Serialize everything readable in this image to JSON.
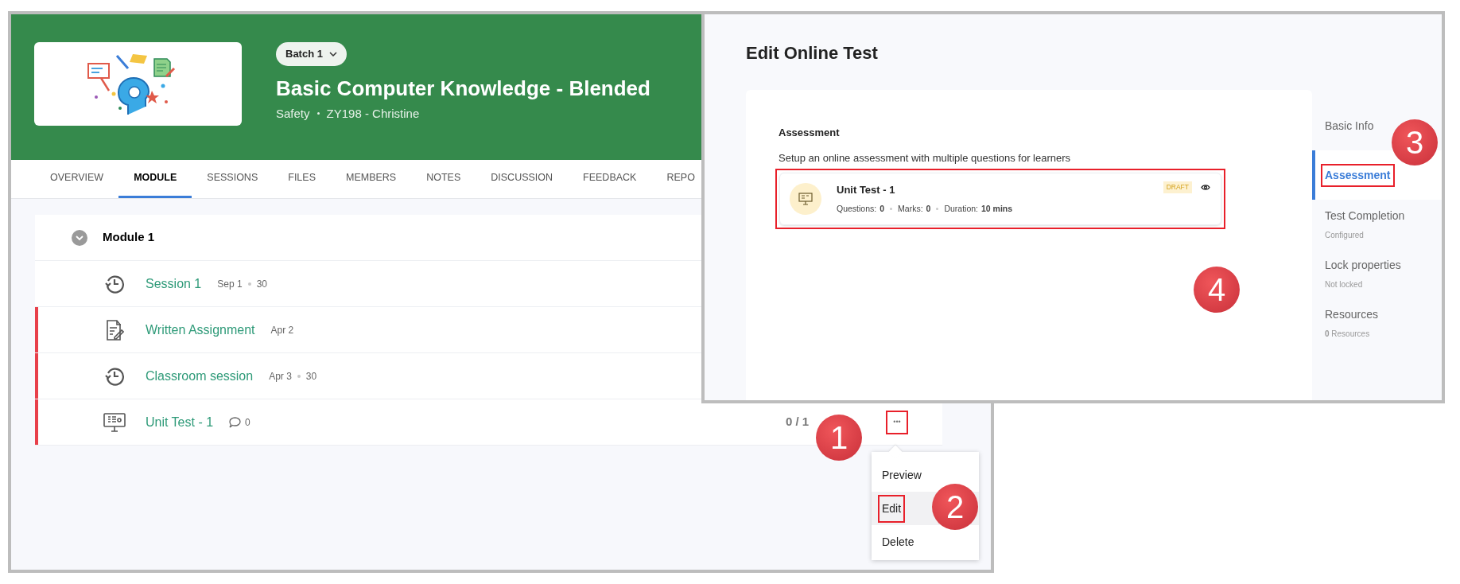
{
  "course_window": {
    "banner": {
      "batch": "Batch 1",
      "title": "Basic Computer Knowledge - Blended",
      "subtitle": [
        "Safety",
        "ZY198 - Christine"
      ]
    },
    "tabs": [
      {
        "label": "OVERVIEW",
        "selected": false
      },
      {
        "label": "MODULE",
        "selected": true
      },
      {
        "label": "SESSIONS",
        "selected": false
      },
      {
        "label": "FILES",
        "selected": false
      },
      {
        "label": "MEMBERS",
        "selected": false
      },
      {
        "label": "NOTES",
        "selected": false
      },
      {
        "label": "DISCUSSION",
        "selected": false
      },
      {
        "label": "FEEDBACK",
        "selected": false
      },
      {
        "label": "REPO",
        "selected": false
      }
    ],
    "module": {
      "title": "Module 1",
      "expanded": true
    },
    "items": [
      {
        "kind": "session",
        "title": "Session 1",
        "meta": [
          "Sep 1",
          "30"
        ],
        "flagged": false
      },
      {
        "kind": "assignment",
        "title": "Written Assignment",
        "meta": [
          "Apr 2"
        ],
        "flagged": true
      },
      {
        "kind": "session",
        "title": "Classroom session",
        "meta": [
          "Apr 3",
          "30"
        ],
        "flagged": true
      },
      {
        "kind": "test",
        "title": "Unit Test - 1",
        "comments": "0",
        "progress": "0 / 1",
        "more": "•••",
        "more_annotated": true,
        "flagged": true
      }
    ],
    "menu": [
      {
        "label": "Preview",
        "hovered": false,
        "annotated": false
      },
      {
        "label": "Edit",
        "hovered": true,
        "annotated": true
      },
      {
        "label": "Delete",
        "hovered": false,
        "annotated": false
      }
    ]
  },
  "edit_window": {
    "title": "Edit Online Test",
    "section_title": "Assessment",
    "description": "Setup an online assessment with multiple questions for learners",
    "test_card": {
      "title": "Unit Test - 1",
      "status": "DRAFT",
      "annotated": true,
      "stats": [
        {
          "label": "Questions:",
          "value": "0"
        },
        {
          "label": "Marks:",
          "value": "0"
        },
        {
          "label": "Duration:",
          "value": "10 mins"
        }
      ]
    },
    "sidebar": [
      {
        "label": "Basic Info",
        "selected": false,
        "annotated": false
      },
      {
        "label": "Assessment",
        "selected": true,
        "annotated": true
      },
      {
        "label": "Test Completion",
        "detail": "Configured",
        "selected": false,
        "annotated": false
      },
      {
        "label": "Lock properties",
        "detail": "Not locked",
        "selected": false,
        "annotated": false
      },
      {
        "label": "Resources",
        "detail": "**0** Resources",
        "selected": false,
        "annotated": false
      }
    ]
  },
  "callouts": [
    "1",
    "2",
    "3",
    "4"
  ]
}
